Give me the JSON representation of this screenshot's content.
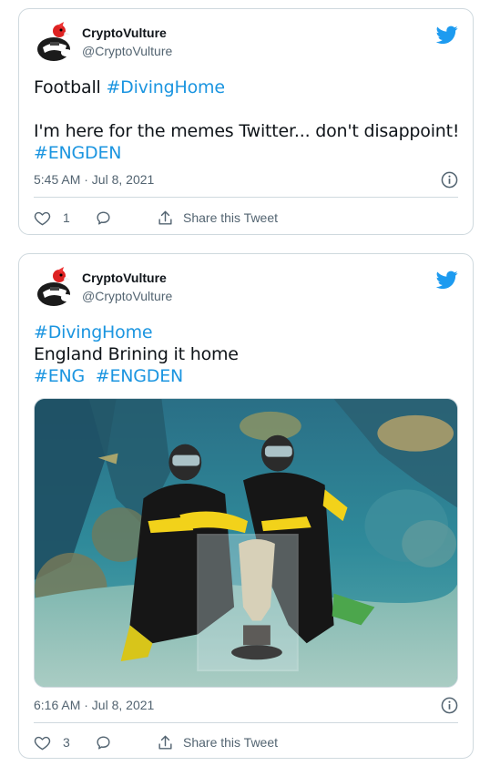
{
  "colors": {
    "accent": "#1b95e0",
    "twitter_blue": "#1d9bf0",
    "text": "#0f1419",
    "muted": "#536471",
    "border": "#cfd9de"
  },
  "tweets": [
    {
      "user": {
        "name": "CryptoVulture",
        "handle": "@CryptoVulture",
        "avatar_icon": "vulture-avatar-icon"
      },
      "lines": [
        {
          "text": "Football ",
          "tag": "#DivingHome"
        },
        {
          "text": "",
          "tag": ""
        },
        {
          "text": "I'm here for the memes Twitter... don't disappoint!",
          "tag": ""
        },
        {
          "text": "",
          "tag": "#ENGDEN"
        }
      ],
      "timestamp": "5:45 AM · Jul 8, 2021",
      "likes": "1",
      "share_label": "Share this Tweet"
    },
    {
      "user": {
        "name": "CryptoVulture",
        "handle": "@CryptoVulture",
        "avatar_icon": "vulture-avatar-icon"
      },
      "lines": [
        {
          "text": "",
          "tag": "#DivingHome"
        },
        {
          "text": "England Brining it home",
          "tag": ""
        },
        {
          "text": "",
          "tag": "#ENG  #ENGDEN"
        }
      ],
      "media": {
        "description_icon": "divers-with-trophy-photo"
      },
      "timestamp": "6:16 AM · Jul 8, 2021",
      "likes": "3",
      "share_label": "Share this Tweet"
    }
  ]
}
